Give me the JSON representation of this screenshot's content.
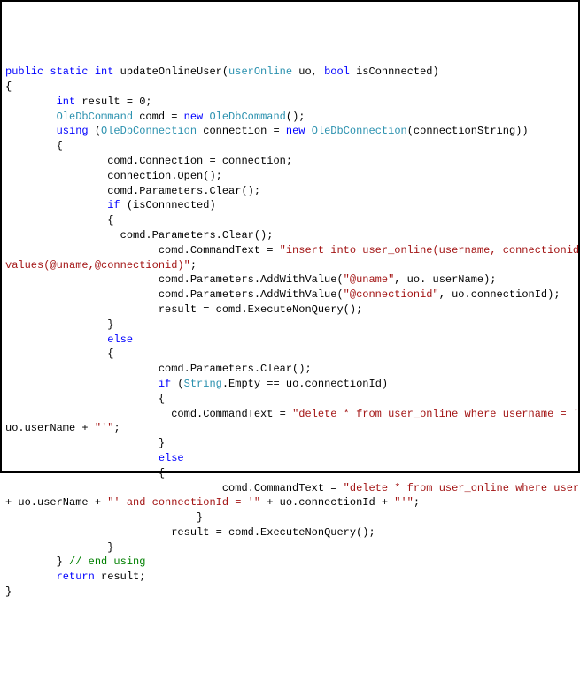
{
  "code": {
    "lines": [
      {
        "indent": 0,
        "segments": [
          {
            "t": "public static int",
            "c": "kw"
          },
          {
            "t": " updateOnlineUser(",
            "c": "txt"
          },
          {
            "t": "userOnline",
            "c": "type"
          },
          {
            "t": " uo, ",
            "c": "txt"
          },
          {
            "t": "bool",
            "c": "kw"
          },
          {
            "t": " isConnnected)",
            "c": "txt"
          }
        ]
      },
      {
        "indent": 0,
        "segments": [
          {
            "t": "{",
            "c": "txt"
          }
        ]
      },
      {
        "indent": 8,
        "segments": [
          {
            "t": "int",
            "c": "kw"
          },
          {
            "t": " result = 0;",
            "c": "txt"
          }
        ]
      },
      {
        "indent": 8,
        "segments": [
          {
            "t": "OleDbCommand",
            "c": "type"
          },
          {
            "t": " comd = ",
            "c": "txt"
          },
          {
            "t": "new",
            "c": "kw"
          },
          {
            "t": " ",
            "c": "txt"
          },
          {
            "t": "OleDbCommand",
            "c": "type"
          },
          {
            "t": "();",
            "c": "txt"
          }
        ]
      },
      {
        "indent": 8,
        "segments": [
          {
            "t": "using",
            "c": "kw"
          },
          {
            "t": " (",
            "c": "txt"
          },
          {
            "t": "OleDbConnection",
            "c": "type"
          },
          {
            "t": " connection = ",
            "c": "txt"
          },
          {
            "t": "new",
            "c": "kw"
          },
          {
            "t": " ",
            "c": "txt"
          },
          {
            "t": "OleDbConnection",
            "c": "type"
          },
          {
            "t": "(connectionString))",
            "c": "txt"
          }
        ]
      },
      {
        "indent": 8,
        "segments": [
          {
            "t": "{",
            "c": "txt"
          }
        ]
      },
      {
        "indent": 16,
        "segments": [
          {
            "t": "comd.Connection = connection;",
            "c": "txt"
          }
        ]
      },
      {
        "indent": 16,
        "segments": [
          {
            "t": "connection.Open();",
            "c": "txt"
          }
        ]
      },
      {
        "indent": 16,
        "segments": [
          {
            "t": "comd.Parameters.Clear();",
            "c": "txt"
          }
        ]
      },
      {
        "indent": 16,
        "segments": [
          {
            "t": "if",
            "c": "kw"
          },
          {
            "t": " (isConnnected)",
            "c": "txt"
          }
        ]
      },
      {
        "indent": 16,
        "segments": [
          {
            "t": "{",
            "c": "txt"
          }
        ]
      },
      {
        "indent": 18,
        "segments": [
          {
            "t": "comd.Parameters.Clear();",
            "c": "txt"
          }
        ]
      },
      {
        "indent": 24,
        "segments": [
          {
            "t": "comd.CommandText = ",
            "c": "txt"
          },
          {
            "t": "\"insert into user_online(username, connectionid) ",
            "c": "str"
          }
        ]
      },
      {
        "indent": 0,
        "segments": [
          {
            "t": "values(@uname,@connectionid)\"",
            "c": "str"
          },
          {
            "t": ";",
            "c": "txt"
          }
        ]
      },
      {
        "indent": 24,
        "segments": [
          {
            "t": "comd.Parameters.AddWithValue(",
            "c": "txt"
          },
          {
            "t": "\"@uname\"",
            "c": "str"
          },
          {
            "t": ", uo. userName);",
            "c": "txt"
          }
        ]
      },
      {
        "indent": 24,
        "segments": [
          {
            "t": "comd.Parameters.AddWithValue(",
            "c": "txt"
          },
          {
            "t": "\"@connectionid\"",
            "c": "str"
          },
          {
            "t": ", uo.connectionId);",
            "c": "txt"
          }
        ]
      },
      {
        "indent": 24,
        "segments": [
          {
            "t": "result = comd.ExecuteNonQuery();",
            "c": "txt"
          }
        ]
      },
      {
        "indent": 16,
        "segments": [
          {
            "t": "}",
            "c": "txt"
          }
        ]
      },
      {
        "indent": 16,
        "segments": [
          {
            "t": "else",
            "c": "kw"
          }
        ]
      },
      {
        "indent": 16,
        "segments": [
          {
            "t": "{",
            "c": "txt"
          }
        ]
      },
      {
        "indent": 24,
        "segments": [
          {
            "t": "comd.Parameters.Clear();",
            "c": "txt"
          }
        ]
      },
      {
        "indent": 24,
        "segments": [
          {
            "t": "if",
            "c": "kw"
          },
          {
            "t": " (",
            "c": "txt"
          },
          {
            "t": "String",
            "c": "type"
          },
          {
            "t": ".Empty == uo.connectionId)",
            "c": "txt"
          }
        ]
      },
      {
        "indent": 24,
        "segments": [
          {
            "t": "{",
            "c": "txt"
          }
        ]
      },
      {
        "indent": 26,
        "segments": [
          {
            "t": "comd.CommandText = ",
            "c": "txt"
          },
          {
            "t": "\"delete * from user_online where username = '\"",
            "c": "str"
          },
          {
            "t": " + ",
            "c": "txt"
          }
        ]
      },
      {
        "indent": 0,
        "segments": [
          {
            "t": "uo.userName + ",
            "c": "txt"
          },
          {
            "t": "\"'\"",
            "c": "str"
          },
          {
            "t": ";",
            "c": "txt"
          }
        ]
      },
      {
        "indent": 24,
        "segments": [
          {
            "t": "}",
            "c": "txt"
          }
        ]
      },
      {
        "indent": 24,
        "segments": [
          {
            "t": "else",
            "c": "kw"
          }
        ]
      },
      {
        "indent": 24,
        "segments": [
          {
            "t": "{",
            "c": "txt"
          }
        ]
      },
      {
        "indent": 34,
        "segments": [
          {
            "t": "comd.CommandText = ",
            "c": "txt"
          },
          {
            "t": "\"delete * from user_online where username = '\"",
            "c": "str"
          },
          {
            "t": " ",
            "c": "txt"
          }
        ]
      },
      {
        "indent": 0,
        "segments": [
          {
            "t": "+ uo.userName + ",
            "c": "txt"
          },
          {
            "t": "\"' and connectionId = '\"",
            "c": "str"
          },
          {
            "t": " + uo.connectionId + ",
            "c": "txt"
          },
          {
            "t": "\"'\"",
            "c": "str"
          },
          {
            "t": ";",
            "c": "txt"
          }
        ]
      },
      {
        "indent": 30,
        "segments": [
          {
            "t": "}",
            "c": "txt"
          }
        ]
      },
      {
        "indent": 26,
        "segments": [
          {
            "t": "result = comd.ExecuteNonQuery();",
            "c": "txt"
          }
        ]
      },
      {
        "indent": 16,
        "segments": [
          {
            "t": "}",
            "c": "txt"
          }
        ]
      },
      {
        "indent": 8,
        "segments": [
          {
            "t": "} ",
            "c": "txt"
          },
          {
            "t": "// end using",
            "c": "cm"
          }
        ]
      },
      {
        "indent": 8,
        "segments": [
          {
            "t": "return",
            "c": "kw"
          },
          {
            "t": " result;",
            "c": "txt"
          }
        ]
      },
      {
        "indent": 0,
        "segments": [
          {
            "t": "}",
            "c": "txt"
          }
        ]
      }
    ]
  }
}
